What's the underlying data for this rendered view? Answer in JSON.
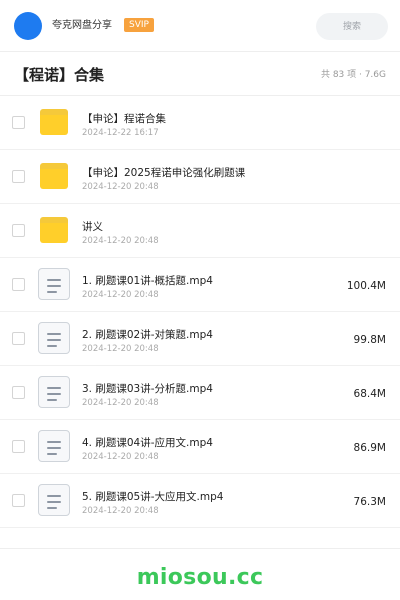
{
  "header": {
    "app_name": "夸克网盘分享",
    "badge": "SVIP",
    "search_placeholder": "搜索"
  },
  "page": {
    "title": "【程诺】合集",
    "summary": "共 83 项 · 7.6G"
  },
  "files": [
    {
      "type": "folder",
      "icon": "folder-icon",
      "name": "【申论】程诺合集",
      "date": "2024-12-22 16:17",
      "size": ""
    },
    {
      "type": "folder",
      "icon": "folder-icon",
      "name": "【申论】2025程诺申论强化刷题课",
      "date": "2024-12-20 20:48",
      "size": ""
    },
    {
      "type": "folder",
      "icon": "folder-icon",
      "name": "讲义",
      "date": "2024-12-20 20:48",
      "size": ""
    },
    {
      "type": "video",
      "icon": "document-icon",
      "name": "1. 刷题课01讲-概括题.mp4",
      "date": "2024-12-20 20:48",
      "size": "100.4M"
    },
    {
      "type": "video",
      "icon": "document-icon",
      "name": "2. 刷题课02讲-对策题.mp4",
      "date": "2024-12-20 20:48",
      "size": "99.8M"
    },
    {
      "type": "video",
      "icon": "document-icon",
      "name": "3. 刷题课03讲-分析题.mp4",
      "date": "2024-12-20 20:48",
      "size": "68.4M"
    },
    {
      "type": "video",
      "icon": "document-icon",
      "name": "4. 刷题课04讲-应用文.mp4",
      "date": "2024-12-20 20:48",
      "size": "86.9M"
    },
    {
      "type": "video",
      "icon": "document-icon",
      "name": "5. 刷题课05讲-大应用文.mp4",
      "date": "2024-12-20 20:48",
      "size": "76.3M"
    }
  ],
  "watermark": "miosou.cc",
  "colors": {
    "avatar": "#1e7bf0",
    "badge": "#f7a23e",
    "folder": "#ffcf2a",
    "watermark": "#3cc85a"
  }
}
